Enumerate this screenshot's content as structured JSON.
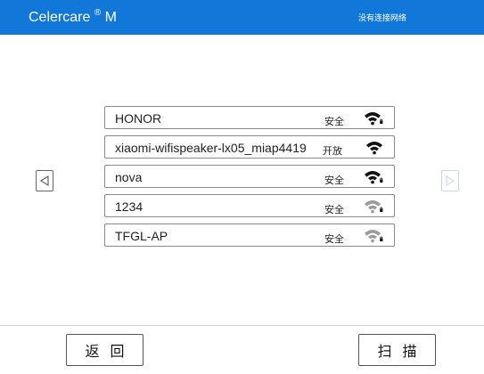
{
  "header": {
    "app_name": "Celercare",
    "reg_mark": "®",
    "app_suffix": "M",
    "network_status": "没有连接网络",
    "bg_color": "#1177d9"
  },
  "wifi_list": [
    {
      "ssid": "HONOR",
      "security": "安全",
      "locked": true,
      "signal": "strong"
    },
    {
      "ssid": "xiaomi-wifispeaker-lx05_miap4419",
      "security": "开放",
      "locked": false,
      "signal": "strong"
    },
    {
      "ssid": "nova",
      "security": "安全",
      "locked": true,
      "signal": "strong"
    },
    {
      "ssid": "1234",
      "security": "安全",
      "locked": true,
      "signal": "weak"
    },
    {
      "ssid": "TFGL-AP",
      "security": "安全",
      "locked": true,
      "signal": "weak"
    }
  ],
  "pagination": {
    "prev_icon": "triangle-left-icon",
    "next_icon": "triangle-right-icon",
    "next_enabled": false
  },
  "footer": {
    "back_label": "返回",
    "scan_label": "扫描"
  }
}
